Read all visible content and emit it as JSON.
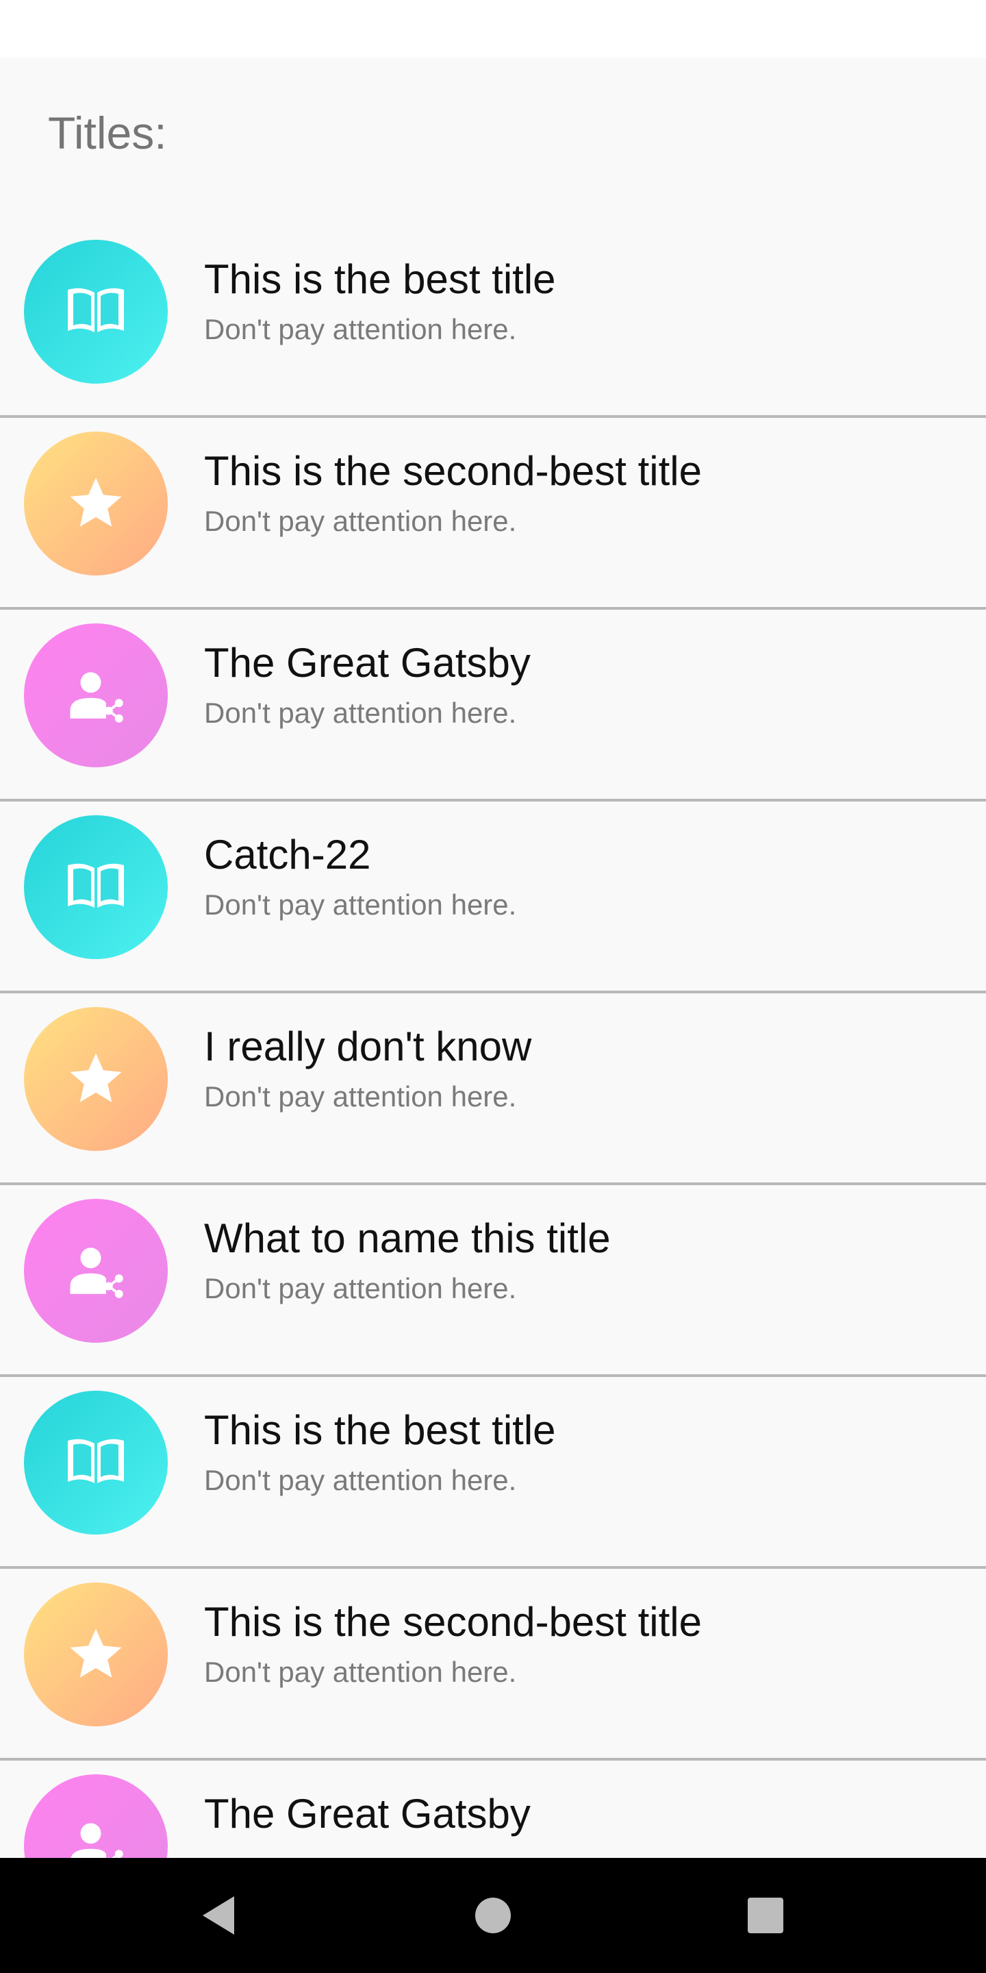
{
  "section_title": "Titles:",
  "items": [
    {
      "title": "This is the best title",
      "subtitle": "Don't pay attention here.",
      "icon": "book-icon"
    },
    {
      "title": "This is the second-best title",
      "subtitle": "Don't pay attention here.",
      "icon": "star-icon"
    },
    {
      "title": "The Great Gatsby",
      "subtitle": "Don't pay attention here.",
      "icon": "person-share-icon"
    },
    {
      "title": "Catch-22",
      "subtitle": "Don't pay attention here.",
      "icon": "book-icon"
    },
    {
      "title": "I really don't know",
      "subtitle": "Don't pay attention here.",
      "icon": "star-icon"
    },
    {
      "title": "What to name this title",
      "subtitle": "Don't pay attention here.",
      "icon": "person-share-icon"
    },
    {
      "title": "This is the best title",
      "subtitle": "Don't pay attention here.",
      "icon": "book-icon"
    },
    {
      "title": "This is the second-best title",
      "subtitle": "Don't pay attention here.",
      "icon": "star-icon"
    },
    {
      "title": "The Great Gatsby",
      "subtitle": "",
      "icon": "person-share-icon"
    }
  ],
  "colors": {
    "book": "#26d4d8",
    "star": "#ffc987",
    "person": "#f486ef"
  },
  "nav": {
    "back": "back-icon",
    "home": "home-icon",
    "recents": "recents-icon"
  }
}
